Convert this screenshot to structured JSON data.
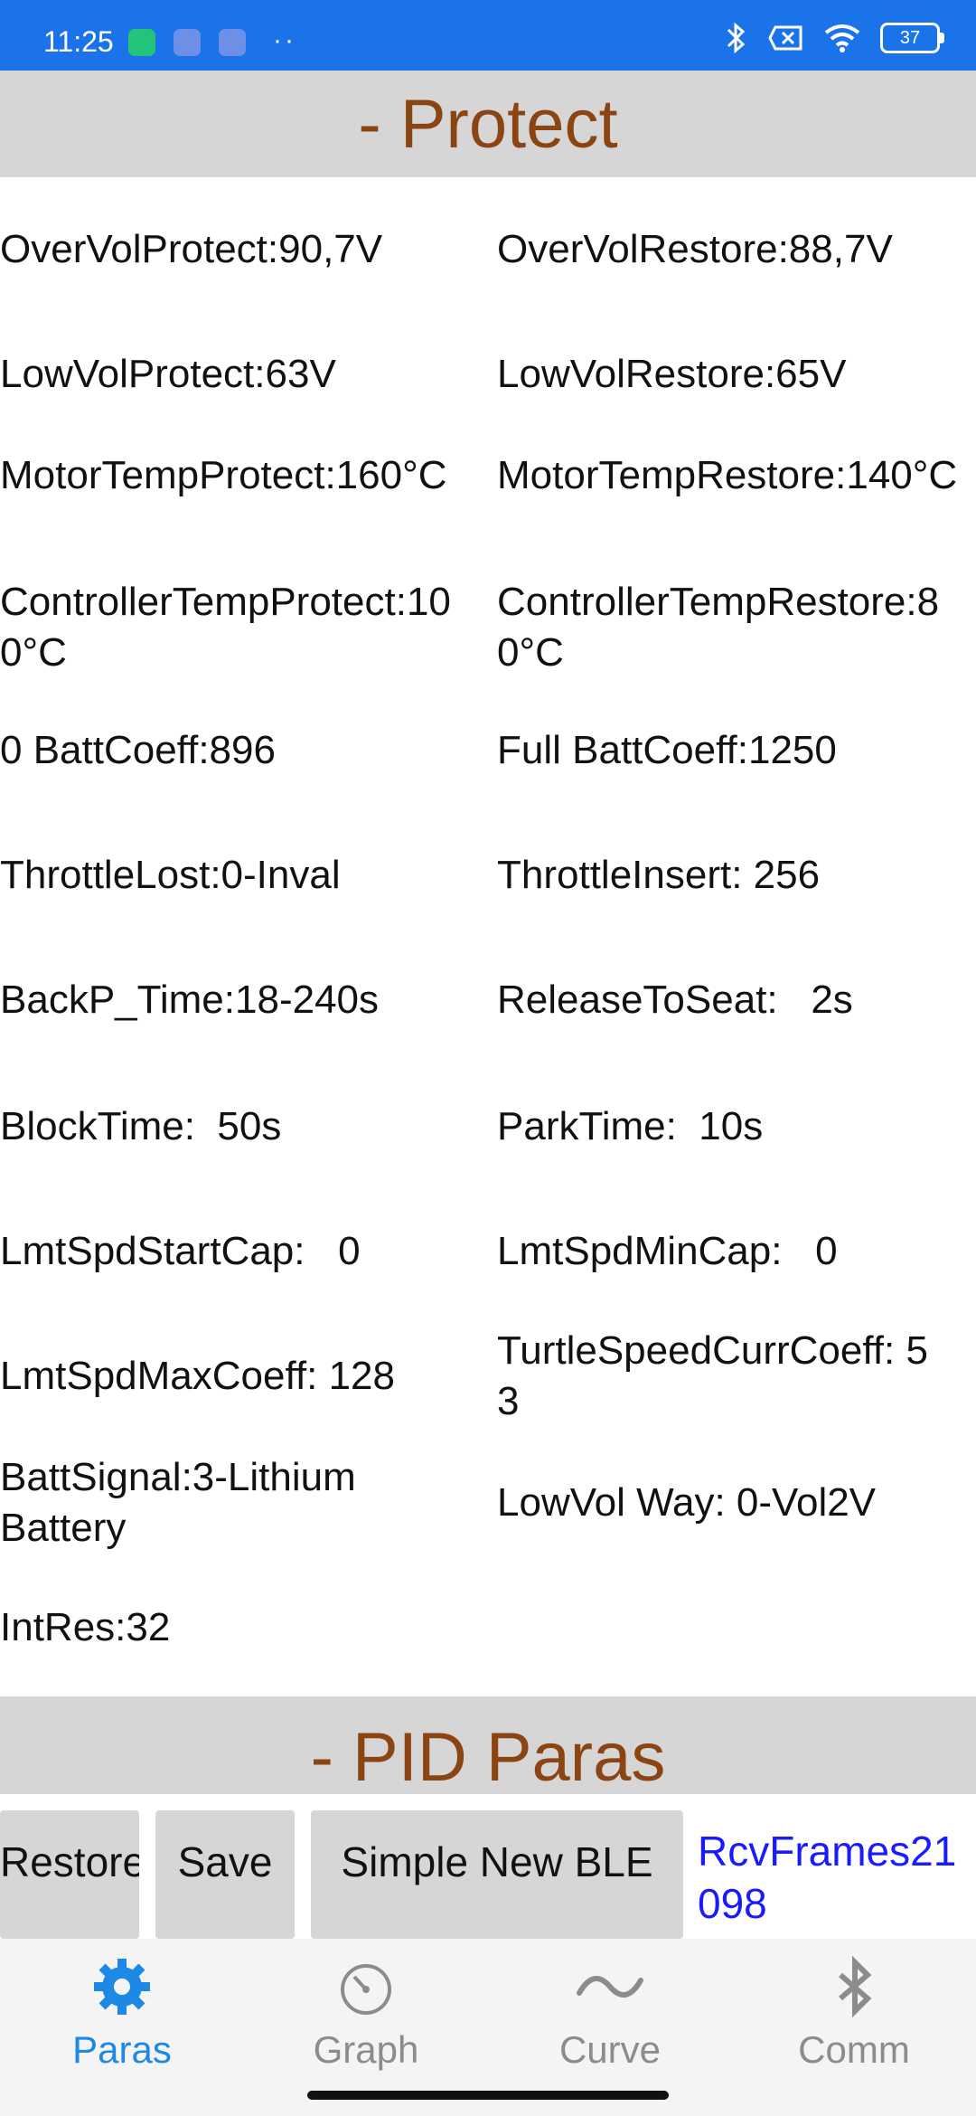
{
  "status_bar": {
    "time": "11:25",
    "battery": "37",
    "icons": [
      "shield-notification-icon",
      "message-icon",
      "message-icon",
      "more-dots-icon",
      "bluetooth-icon",
      "no-sim-icon",
      "wifi-icon",
      "battery-icon"
    ]
  },
  "sections": {
    "protect_title": "- Protect",
    "pid_title": "- PID Paras"
  },
  "params": [
    {
      "left": "OverVolProtect:90,7V",
      "right": "OverVolRestore:88,7V"
    },
    {
      "left": "LowVolProtect:63V",
      "right": "LowVolRestore:65V"
    },
    {
      "left": "MotorTempProtect:160°C",
      "right": "MotorTempRestore:140°C"
    },
    {
      "left": "ControllerTempProtect:100°C",
      "right": "ControllerTempRestore:80°C"
    },
    {
      "left": "0 BattCoeff:896",
      "right": "Full BattCoeff:1250"
    },
    {
      "left": "ThrottleLost:0-Inval",
      "right": "ThrottleInsert: 256"
    },
    {
      "left": "BackP_Time:18-240s",
      "right": "ReleaseToSeat:   2s"
    },
    {
      "left": "BlockTime:  50s",
      "right": "ParkTime:  10s"
    },
    {
      "left": "LmtSpdStartCap:   0",
      "right": "LmtSpdMinCap:   0"
    },
    {
      "left": "LmtSpdMaxCoeff: 128",
      "right": "TurtleSpeedCurrCoeff: 53"
    },
    {
      "left": "BattSignal:3-Lithium Battery",
      "right": "LowVol Way: 0-Vol2V"
    },
    {
      "left": "IntRes:32",
      "right": ""
    }
  ],
  "buttons": {
    "restore": "Restore",
    "save": "Save",
    "simple_new_ble": "Simple New BLE",
    "rcv_frames": "RcvFrames21098"
  },
  "nav": {
    "paras": "Paras",
    "graph": "Graph",
    "curve": "Curve",
    "comm": "Comm"
  },
  "colors": {
    "status_bar": "#1a73e8",
    "section_title": "#8b4513",
    "section_bg": "#d6d6d6",
    "active_nav": "#1e88e5",
    "rcv_text": "#1a1aff"
  }
}
